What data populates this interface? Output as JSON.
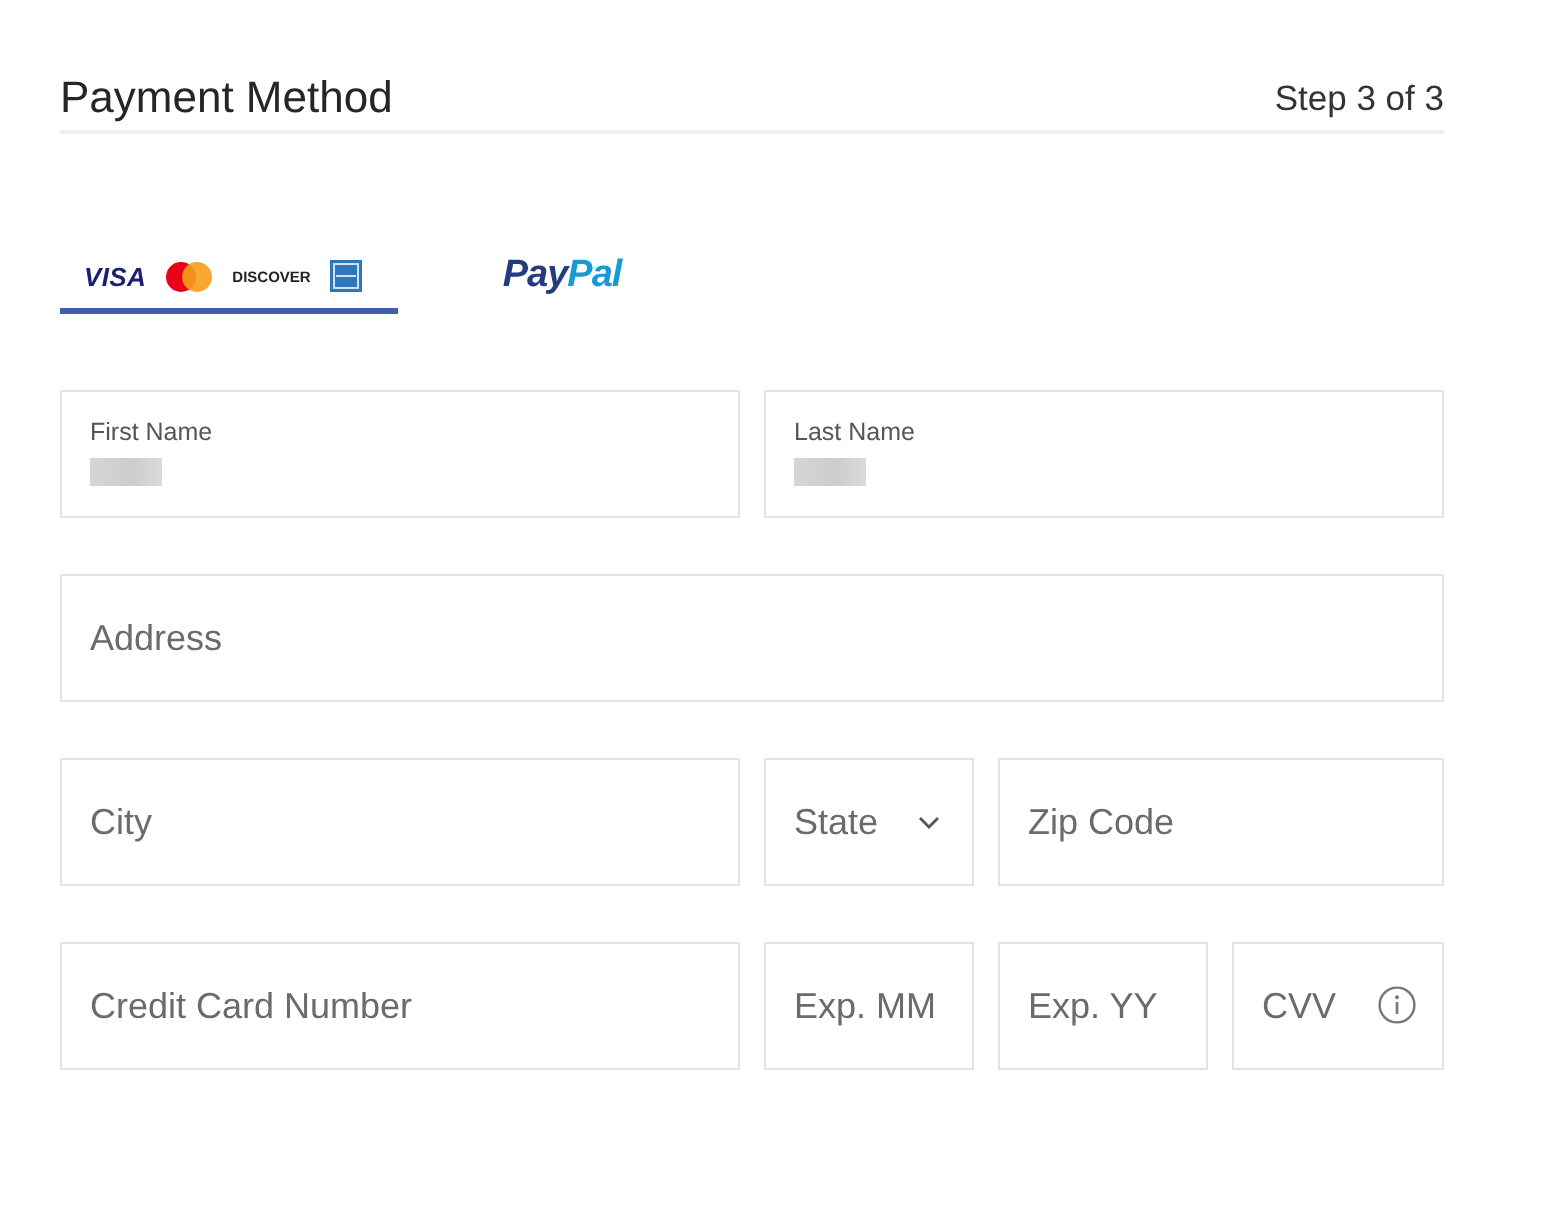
{
  "header": {
    "title": "Payment Method",
    "step": "Step 3 of 3"
  },
  "payment_tabs": [
    {
      "kind": "cards",
      "selected": true,
      "logos": [
        {
          "kind": "wordmark",
          "text": "VISA"
        },
        {
          "kind": "circles"
        },
        {
          "kind": "minimark",
          "text": "DISCOVER"
        },
        {
          "kind": "tile"
        }
      ]
    },
    {
      "kind": "paypal",
      "selected": false,
      "label_parts": [
        "Pay",
        "Pal"
      ]
    }
  ],
  "form_rows": [
    [
      {
        "kind": "input",
        "label": "First Name",
        "value_blurred": true
      },
      {
        "kind": "input",
        "label": "Last Name",
        "value_blurred": true
      }
    ],
    [
      {
        "kind": "input",
        "placeholder": "Address"
      }
    ],
    [
      {
        "kind": "input",
        "placeholder": "City"
      },
      {
        "kind": "select",
        "placeholder": "State"
      },
      {
        "kind": "input",
        "placeholder": "Zip Code"
      }
    ],
    [
      {
        "kind": "input",
        "placeholder": "Credit Card Number"
      },
      {
        "kind": "input",
        "placeholder": "Exp. MM"
      },
      {
        "kind": "input",
        "placeholder": "Exp. YY"
      },
      {
        "kind": "input",
        "placeholder": "CVV",
        "info": true
      }
    ]
  ]
}
